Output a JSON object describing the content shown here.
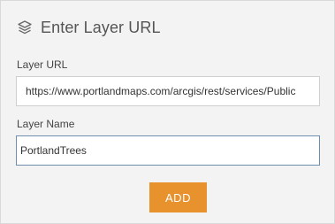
{
  "header": {
    "icon": "layers-icon",
    "title": "Enter Layer URL"
  },
  "form": {
    "layer_url": {
      "label": "Layer URL",
      "value": "https://www.portlandmaps.com/arcgis/rest/services/Public"
    },
    "layer_name": {
      "label": "Layer Name",
      "value": "PortlandTrees"
    },
    "add_button_label": "ADD"
  },
  "colors": {
    "panel_background": "#f3f3f3",
    "button_accent": "#e8922e",
    "focused_input_border": "#6e8fb0"
  }
}
